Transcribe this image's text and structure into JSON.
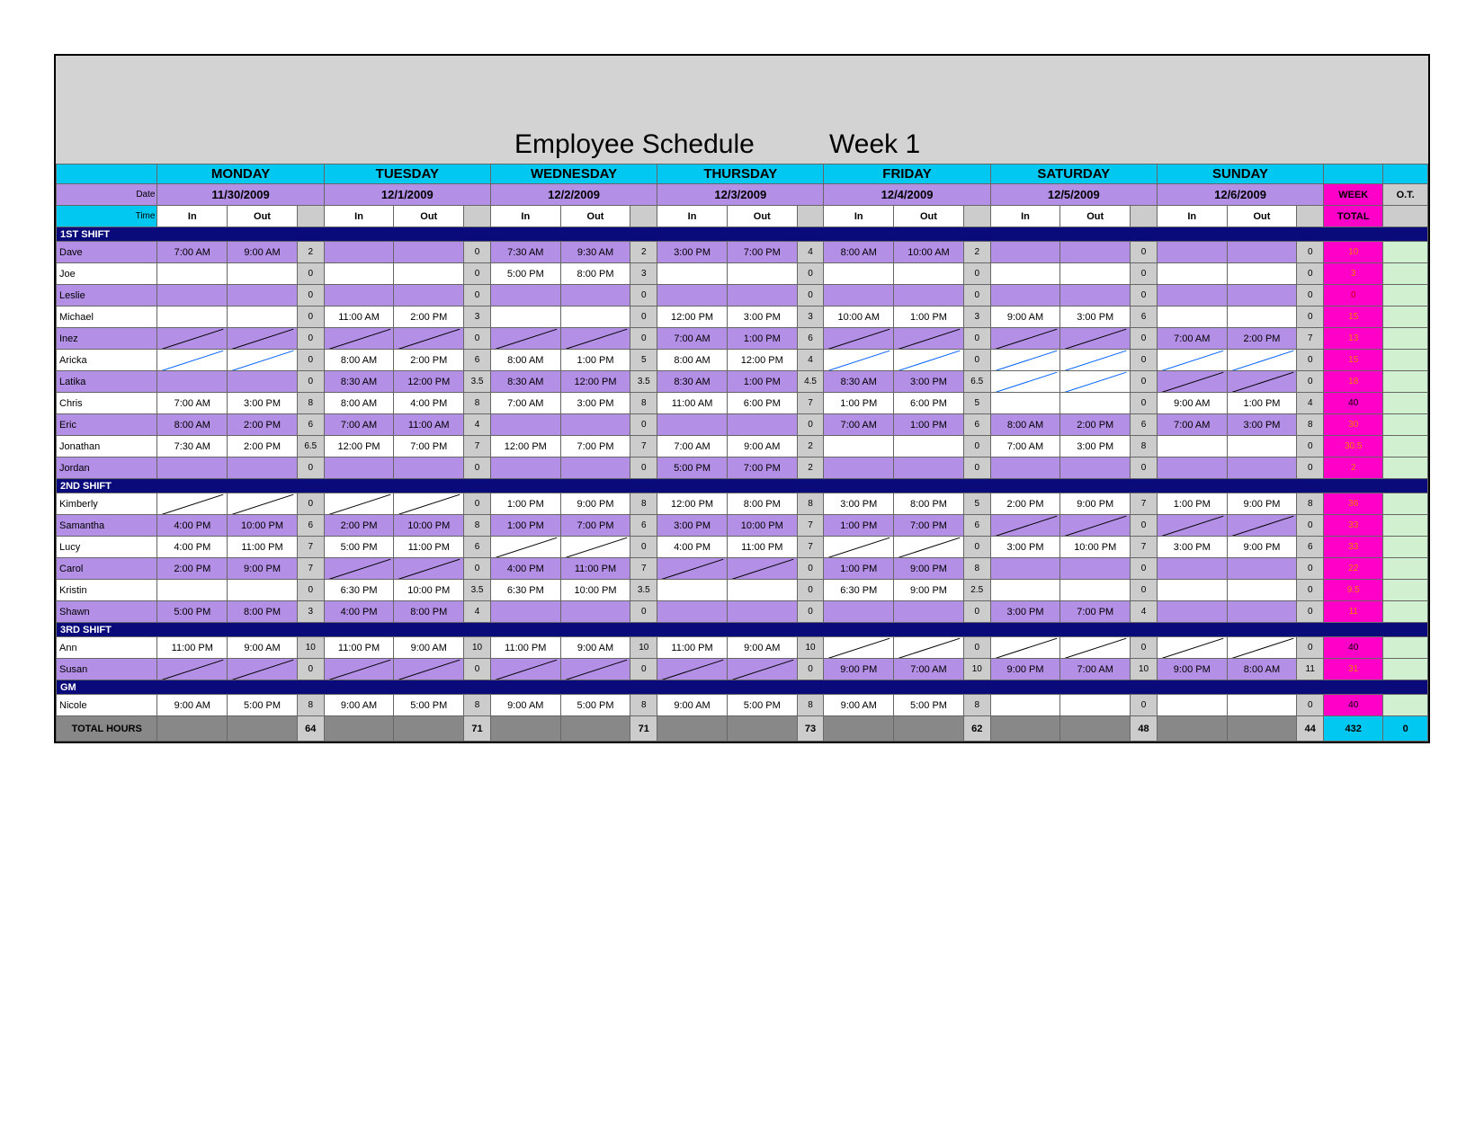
{
  "title": "Employee Schedule",
  "week": "Week 1",
  "labels": {
    "date": "Date",
    "time": "Time",
    "in": "In",
    "out": "Out",
    "week": "WEEK",
    "ot": "O.T.",
    "total": "TOTAL",
    "totalhours": "TOTAL HOURS"
  },
  "days": [
    {
      "name": "MONDAY",
      "date": "11/30/2009"
    },
    {
      "name": "TUESDAY",
      "date": "12/1/2009"
    },
    {
      "name": "WEDNESDAY",
      "date": "12/2/2009"
    },
    {
      "name": "THURSDAY",
      "date": "12/3/2009"
    },
    {
      "name": "FRIDAY",
      "date": "12/4/2009"
    },
    {
      "name": "SATURDAY",
      "date": "12/5/2009"
    },
    {
      "name": "SUNDAY",
      "date": "12/6/2009"
    }
  ],
  "sections": [
    "1ST SHIFT",
    "2ND SHIFT",
    "3RD SHIFT",
    "GM"
  ],
  "shift1": [
    {
      "nm": "Dave",
      "alt": true,
      "d": [
        {
          "i": "7:00 AM",
          "o": "9:00 AM",
          "h": "2"
        },
        {
          "i": "",
          "o": "",
          "h": "0"
        },
        {
          "i": "7:30 AM",
          "o": "9:30 AM",
          "h": "2"
        },
        {
          "i": "3:00 PM",
          "o": "7:00 PM",
          "h": "4"
        },
        {
          "i": "8:00 AM",
          "o": "10:00 AM",
          "h": "2"
        },
        {
          "i": "",
          "o": "",
          "h": "0"
        },
        {
          "i": "",
          "o": "",
          "h": "0"
        }
      ],
      "wk": "10",
      "wkc": "o"
    },
    {
      "nm": "Joe",
      "alt": false,
      "d": [
        {
          "i": "",
          "o": "",
          "h": "0"
        },
        {
          "i": "",
          "o": "",
          "h": "0"
        },
        {
          "i": "5:00 PM",
          "o": "8:00 PM",
          "h": "3"
        },
        {
          "i": "",
          "o": "",
          "h": "0"
        },
        {
          "i": "",
          "o": "",
          "h": "0"
        },
        {
          "i": "",
          "o": "",
          "h": "0"
        },
        {
          "i": "",
          "o": "",
          "h": "0"
        }
      ],
      "wk": "3",
      "wkc": "o"
    },
    {
      "nm": "Leslie",
      "alt": true,
      "d": [
        {
          "i": "",
          "o": "",
          "h": "0"
        },
        {
          "i": "",
          "o": "",
          "h": "0"
        },
        {
          "i": "",
          "o": "",
          "h": "0"
        },
        {
          "i": "",
          "o": "",
          "h": "0"
        },
        {
          "i": "",
          "o": "",
          "h": "0"
        },
        {
          "i": "",
          "o": "",
          "h": "0"
        },
        {
          "i": "",
          "o": "",
          "h": "0"
        }
      ],
      "wk": "0",
      "wkc": "r"
    },
    {
      "nm": "Michael",
      "alt": false,
      "d": [
        {
          "i": "",
          "o": "",
          "h": "0"
        },
        {
          "i": "11:00 AM",
          "o": "2:00 PM",
          "h": "3"
        },
        {
          "i": "",
          "o": "",
          "h": "0"
        },
        {
          "i": "12:00 PM",
          "o": "3:00 PM",
          "h": "3"
        },
        {
          "i": "10:00 AM",
          "o": "1:00 PM",
          "h": "3"
        },
        {
          "i": "9:00 AM",
          "o": "3:00 PM",
          "h": "6"
        },
        {
          "i": "",
          "o": "",
          "h": "0"
        }
      ],
      "wk": "15",
      "wkc": "o"
    },
    {
      "nm": "Inez",
      "alt": true,
      "d": [
        {
          "i": "/",
          "o": "/",
          "h": "0"
        },
        {
          "i": "/",
          "o": "/",
          "h": "0"
        },
        {
          "i": "/",
          "o": "/",
          "h": "0"
        },
        {
          "i": "7:00 AM",
          "o": "1:00 PM",
          "h": "6"
        },
        {
          "i": "/",
          "o": "/",
          "h": "0"
        },
        {
          "i": "/",
          "o": "/",
          "h": "0"
        },
        {
          "i": "7:00 AM",
          "o": "2:00 PM",
          "h": "7"
        }
      ],
      "wk": "13",
      "wkc": "o"
    },
    {
      "nm": "Aricka",
      "alt": false,
      "d": [
        {
          "i": "b",
          "o": "b",
          "h": "0"
        },
        {
          "i": "8:00 AM",
          "o": "2:00 PM",
          "h": "6"
        },
        {
          "i": "8:00 AM",
          "o": "1:00 PM",
          "h": "5"
        },
        {
          "i": "8:00 AM",
          "o": "12:00 PM",
          "h": "4"
        },
        {
          "i": "b",
          "o": "b",
          "h": "0"
        },
        {
          "i": "b",
          "o": "b",
          "h": "0"
        },
        {
          "i": "b",
          "o": "b",
          "h": "0"
        }
      ],
      "wk": "15",
      "wkc": "o"
    },
    {
      "nm": "Latika",
      "alt": true,
      "d": [
        {
          "i": "",
          "o": "",
          "h": "0"
        },
        {
          "i": "8:30 AM",
          "o": "12:00 PM",
          "h": "3.5"
        },
        {
          "i": "8:30 AM",
          "o": "12:00 PM",
          "h": "3.5"
        },
        {
          "i": "8:30 AM",
          "o": "1:00 PM",
          "h": "4.5"
        },
        {
          "i": "8:30 AM",
          "o": "3:00 PM",
          "h": "6.5"
        },
        {
          "i": "b",
          "o": "b",
          "h": "0"
        },
        {
          "i": "/",
          "o": "/",
          "h": "0"
        }
      ],
      "wk": "18",
      "wkc": "o"
    },
    {
      "nm": "Chris",
      "alt": false,
      "d": [
        {
          "i": "7:00 AM",
          "o": "3:00 PM",
          "h": "8"
        },
        {
          "i": "8:00 AM",
          "o": "4:00 PM",
          "h": "8"
        },
        {
          "i": "7:00 AM",
          "o": "3:00 PM",
          "h": "8"
        },
        {
          "i": "11:00 AM",
          "o": "6:00 PM",
          "h": "7"
        },
        {
          "i": "1:00 PM",
          "o": "6:00 PM",
          "h": "5"
        },
        {
          "i": "",
          "o": "",
          "h": "0"
        },
        {
          "i": "9:00 AM",
          "o": "1:00 PM",
          "h": "4"
        }
      ],
      "wk": "40",
      "wkc": "k"
    },
    {
      "nm": "Eric",
      "alt": true,
      "d": [
        {
          "i": "8:00 AM",
          "o": "2:00 PM",
          "h": "6"
        },
        {
          "i": "7:00 AM",
          "o": "11:00 AM",
          "h": "4"
        },
        {
          "i": "",
          "o": "",
          "h": "0"
        },
        {
          "i": "",
          "o": "",
          "h": "0"
        },
        {
          "i": "7:00 AM",
          "o": "1:00 PM",
          "h": "6"
        },
        {
          "i": "8:00 AM",
          "o": "2:00 PM",
          "h": "6"
        },
        {
          "i": "7:00 AM",
          "o": "3:00 PM",
          "h": "8"
        }
      ],
      "wk": "30",
      "wkc": "o"
    },
    {
      "nm": "Jonathan",
      "alt": false,
      "d": [
        {
          "i": "7:30 AM",
          "o": "2:00 PM",
          "h": "6.5"
        },
        {
          "i": "12:00 PM",
          "o": "7:00 PM",
          "h": "7"
        },
        {
          "i": "12:00 PM",
          "o": "7:00 PM",
          "h": "7"
        },
        {
          "i": "7:00 AM",
          "o": "9:00 AM",
          "h": "2"
        },
        {
          "i": "",
          "o": "",
          "h": "0"
        },
        {
          "i": "7:00 AM",
          "o": "3:00 PM",
          "h": "8"
        },
        {
          "i": "",
          "o": "",
          "h": "0"
        }
      ],
      "wk": "30.5",
      "wkc": "o"
    },
    {
      "nm": "Jordan",
      "alt": true,
      "d": [
        {
          "i": "",
          "o": "",
          "h": "0"
        },
        {
          "i": "",
          "o": "",
          "h": "0"
        },
        {
          "i": "",
          "o": "",
          "h": "0"
        },
        {
          "i": "5:00 PM",
          "o": "7:00 PM",
          "h": "2"
        },
        {
          "i": "",
          "o": "",
          "h": "0"
        },
        {
          "i": "",
          "o": "",
          "h": "0"
        },
        {
          "i": "",
          "o": "",
          "h": "0"
        }
      ],
      "wk": "2",
      "wkc": "o"
    }
  ],
  "shift2": [
    {
      "nm": "Kimberly",
      "alt": false,
      "d": [
        {
          "i": "/",
          "o": "/",
          "h": "0"
        },
        {
          "i": "/",
          "o": "/",
          "h": "0"
        },
        {
          "i": "1:00 PM",
          "o": "9:00 PM",
          "h": "8"
        },
        {
          "i": "12:00 PM",
          "o": "8:00 PM",
          "h": "8"
        },
        {
          "i": "3:00 PM",
          "o": "8:00 PM",
          "h": "5"
        },
        {
          "i": "2:00 PM",
          "o": "9:00 PM",
          "h": "7"
        },
        {
          "i": "1:00 PM",
          "o": "9:00 PM",
          "h": "8"
        }
      ],
      "wk": "36",
      "wkc": "o"
    },
    {
      "nm": "Samantha",
      "alt": true,
      "d": [
        {
          "i": "4:00 PM",
          "o": "10:00 PM",
          "h": "6"
        },
        {
          "i": "2:00 PM",
          "o": "10:00 PM",
          "h": "8"
        },
        {
          "i": "1:00 PM",
          "o": "7:00 PM",
          "h": "6"
        },
        {
          "i": "3:00 PM",
          "o": "10:00 PM",
          "h": "7"
        },
        {
          "i": "1:00 PM",
          "o": "7:00 PM",
          "h": "6"
        },
        {
          "i": "/",
          "o": "/",
          "h": "0"
        },
        {
          "i": "/",
          "o": "/",
          "h": "0"
        }
      ],
      "wk": "33",
      "wkc": "o"
    },
    {
      "nm": "Lucy",
      "alt": false,
      "d": [
        {
          "i": "4:00 PM",
          "o": "11:00 PM",
          "h": "7"
        },
        {
          "i": "5:00 PM",
          "o": "11:00 PM",
          "h": "6"
        },
        {
          "i": "/",
          "o": "/",
          "h": "0"
        },
        {
          "i": "4:00 PM",
          "o": "11:00 PM",
          "h": "7"
        },
        {
          "i": "/",
          "o": "/",
          "h": "0"
        },
        {
          "i": "3:00 PM",
          "o": "10:00 PM",
          "h": "7"
        },
        {
          "i": "3:00 PM",
          "o": "9:00 PM",
          "h": "6"
        }
      ],
      "wk": "33",
      "wkc": "o"
    },
    {
      "nm": "Carol",
      "alt": true,
      "d": [
        {
          "i": "2:00 PM",
          "o": "9:00 PM",
          "h": "7"
        },
        {
          "i": "/",
          "o": "/",
          "h": "0"
        },
        {
          "i": "4:00 PM",
          "o": "11:00 PM",
          "h": "7"
        },
        {
          "i": "/",
          "o": "/",
          "h": "0"
        },
        {
          "i": "1:00 PM",
          "o": "9:00 PM",
          "h": "8"
        },
        {
          "i": "",
          "o": "",
          "h": "0"
        },
        {
          "i": "",
          "o": "",
          "h": "0"
        }
      ],
      "wk": "22",
      "wkc": "o"
    },
    {
      "nm": "Kristin",
      "alt": false,
      "d": [
        {
          "i": "",
          "o": "",
          "h": "0"
        },
        {
          "i": "6:30 PM",
          "o": "10:00 PM",
          "h": "3.5"
        },
        {
          "i": "6:30 PM",
          "o": "10:00 PM",
          "h": "3.5"
        },
        {
          "i": "",
          "o": "",
          "h": "0"
        },
        {
          "i": "6:30 PM",
          "o": "9:00 PM",
          "h": "2.5"
        },
        {
          "i": "",
          "o": "",
          "h": "0"
        },
        {
          "i": "",
          "o": "",
          "h": "0"
        }
      ],
      "wk": "9.5",
      "wkc": "o"
    },
    {
      "nm": "Shawn",
      "alt": true,
      "d": [
        {
          "i": "5:00 PM",
          "o": "8:00 PM",
          "h": "3"
        },
        {
          "i": "4:00 PM",
          "o": "8:00 PM",
          "h": "4"
        },
        {
          "i": "",
          "o": "",
          "h": "0"
        },
        {
          "i": "",
          "o": "",
          "h": "0"
        },
        {
          "i": "",
          "o": "",
          "h": "0"
        },
        {
          "i": "3:00 PM",
          "o": "7:00 PM",
          "h": "4"
        },
        {
          "i": "",
          "o": "",
          "h": "0"
        }
      ],
      "wk": "11",
      "wkc": "o"
    }
  ],
  "shift3": [
    {
      "nm": "Ann",
      "alt": false,
      "d": [
        {
          "i": "11:00 PM",
          "o": "9:00 AM",
          "h": "10"
        },
        {
          "i": "11:00 PM",
          "o": "9:00 AM",
          "h": "10"
        },
        {
          "i": "11:00 PM",
          "o": "9:00 AM",
          "h": "10"
        },
        {
          "i": "11:00 PM",
          "o": "9:00 AM",
          "h": "10"
        },
        {
          "i": "/",
          "o": "/",
          "h": "0"
        },
        {
          "i": "/",
          "o": "/",
          "h": "0"
        },
        {
          "i": "/",
          "o": "/",
          "h": "0"
        }
      ],
      "wk": "40",
      "wkc": "k"
    },
    {
      "nm": "Susan",
      "alt": true,
      "d": [
        {
          "i": "/",
          "o": "/",
          "h": "0"
        },
        {
          "i": "/",
          "o": "/",
          "h": "0"
        },
        {
          "i": "/",
          "o": "/",
          "h": "0"
        },
        {
          "i": "/",
          "o": "/",
          "h": "0"
        },
        {
          "i": "9:00 PM",
          "o": "7:00 AM",
          "h": "10"
        },
        {
          "i": "9:00 PM",
          "o": "7:00 AM",
          "h": "10"
        },
        {
          "i": "9:00 PM",
          "o": "8:00 AM",
          "h": "11"
        }
      ],
      "wk": "31",
      "wkc": "o"
    }
  ],
  "gm": [
    {
      "nm": "Nicole",
      "alt": false,
      "d": [
        {
          "i": "9:00 AM",
          "o": "5:00 PM",
          "h": "8"
        },
        {
          "i": "9:00 AM",
          "o": "5:00 PM",
          "h": "8"
        },
        {
          "i": "9:00 AM",
          "o": "5:00 PM",
          "h": "8"
        },
        {
          "i": "9:00 AM",
          "o": "5:00 PM",
          "h": "8"
        },
        {
          "i": "9:00 AM",
          "o": "5:00 PM",
          "h": "8"
        },
        {
          "i": "",
          "o": "",
          "h": "0"
        },
        {
          "i": "",
          "o": "",
          "h": "0"
        }
      ],
      "wk": "40",
      "wkc": "k"
    }
  ],
  "totals": {
    "days": [
      "64",
      "71",
      "71",
      "73",
      "62",
      "48",
      "44"
    ],
    "week": "432",
    "ot": "0"
  }
}
